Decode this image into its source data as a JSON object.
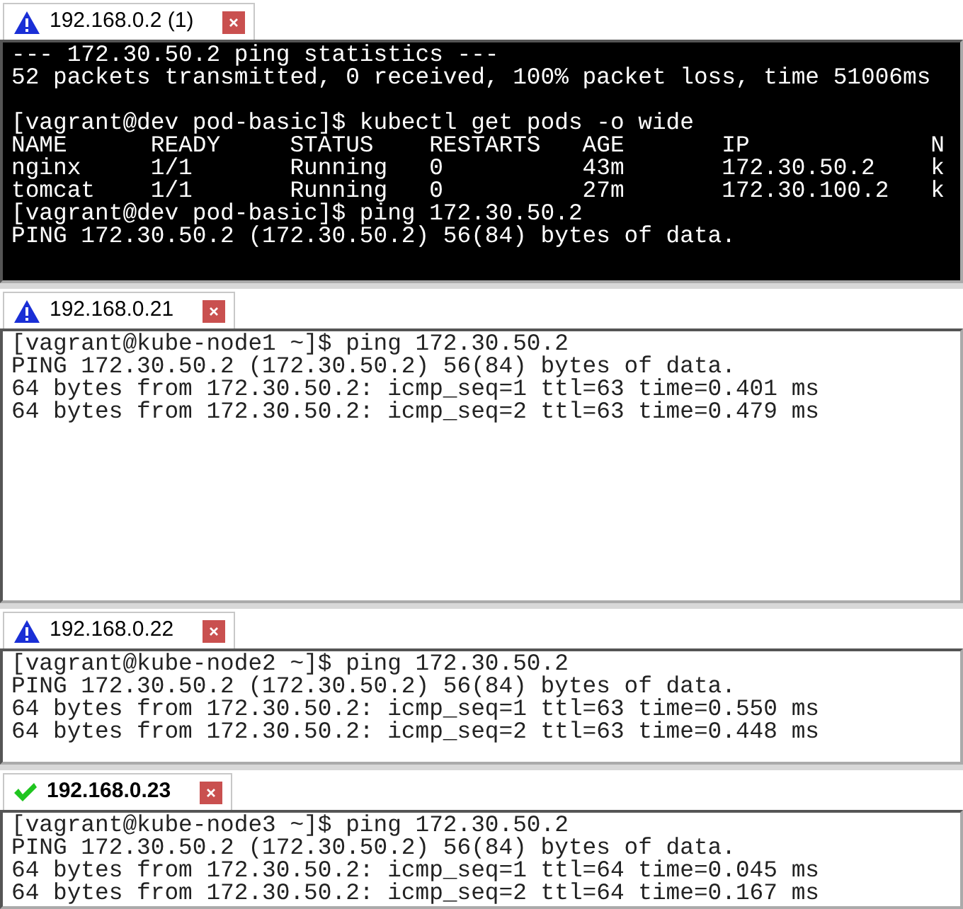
{
  "sessions": [
    {
      "title": "192.168.0.2 (1)",
      "connected": false,
      "selected": false,
      "dark": true,
      "paragraphs": [
        [
          "--- 172.30.50.2 ping statistics ---",
          "52 packets transmitted, 0 received, 100% packet loss, time 51006ms"
        ],
        [
          "[vagrant@dev pod-basic]$ kubectl get pods -o wide",
          "NAME      READY     STATUS    RESTARTS   AGE       IP             N",
          "nginx     1/1       Running   0          43m       172.30.50.2    k",
          "tomcat    1/1       Running   0          27m       172.30.100.2   k",
          "[vagrant@dev pod-basic]$ ping 172.30.50.2",
          "PING 172.30.50.2 (172.30.50.2) 56(84) bytes of data."
        ]
      ]
    },
    {
      "title": "192.168.0.21",
      "connected": false,
      "selected": false,
      "dark": false,
      "paragraphs": [
        [
          "[vagrant@kube-node1 ~]$ ping 172.30.50.2",
          "PING 172.30.50.2 (172.30.50.2) 56(84) bytes of data.",
          "64 bytes from 172.30.50.2: icmp_seq=1 ttl=63 time=0.401 ms",
          "64 bytes from 172.30.50.2: icmp_seq=2 ttl=63 time=0.479 ms"
        ]
      ]
    },
    {
      "title": "192.168.0.22",
      "connected": false,
      "selected": false,
      "dark": false,
      "paragraphs": [
        [
          "[vagrant@kube-node2 ~]$ ping 172.30.50.2",
          "PING 172.30.50.2 (172.30.50.2) 56(84) bytes of data.",
          "64 bytes from 172.30.50.2: icmp_seq=1 ttl=63 time=0.550 ms",
          "64 bytes from 172.30.50.2: icmp_seq=2 ttl=63 time=0.448 ms"
        ]
      ]
    },
    {
      "title": "192.168.0.23",
      "connected": true,
      "selected": true,
      "dark": false,
      "paragraphs": [
        [
          "[vagrant@kube-node3 ~]$ ping 172.30.50.2",
          "PING 172.30.50.2 (172.30.50.2) 56(84) bytes of data.",
          "64 bytes from 172.30.50.2: icmp_seq=1 ttl=64 time=0.045 ms",
          "64 bytes from 172.30.50.2: icmp_seq=2 ttl=64 time=0.167 ms"
        ]
      ]
    }
  ]
}
